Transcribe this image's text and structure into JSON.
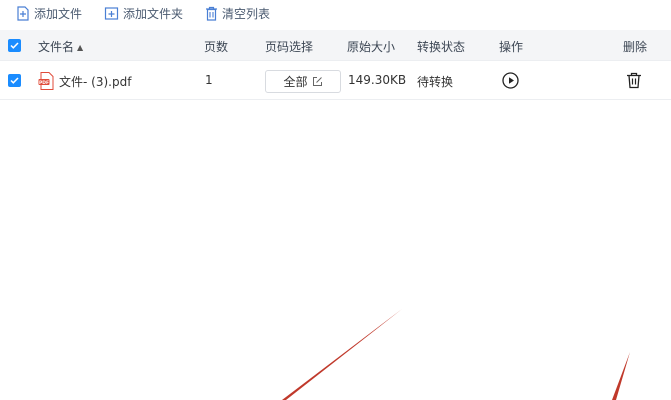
{
  "toolbar": {
    "add_file": "添加文件",
    "add_folder": "添加文件夹",
    "clear_list": "清空列表",
    "icon_color": "#4a7fd4"
  },
  "table": {
    "columns": {
      "filename": "文件名",
      "pages": "页数",
      "page_select": "页码选择",
      "original_size": "原始大小",
      "status": "转换状态",
      "action": "操作",
      "delete": "删除"
    },
    "rows": [
      {
        "filename": "文件- (3).pdf",
        "pages": "1",
        "page_select": "全部",
        "original_size": "149.30KB",
        "status": "待转换",
        "checked": true
      }
    ]
  },
  "colors": {
    "accent": "#1a8cff",
    "header_bg": "#f4f5f7",
    "pdf_icon": "#e04b3a",
    "decor_line": "#c0392b"
  },
  "icons": {
    "add_file": "add-file-icon",
    "add_folder": "add-folder-icon",
    "clear": "clear-list-icon",
    "pdf": "pdf-file-icon",
    "edit": "edit-icon",
    "play": "play-icon",
    "delete": "trash-icon"
  }
}
